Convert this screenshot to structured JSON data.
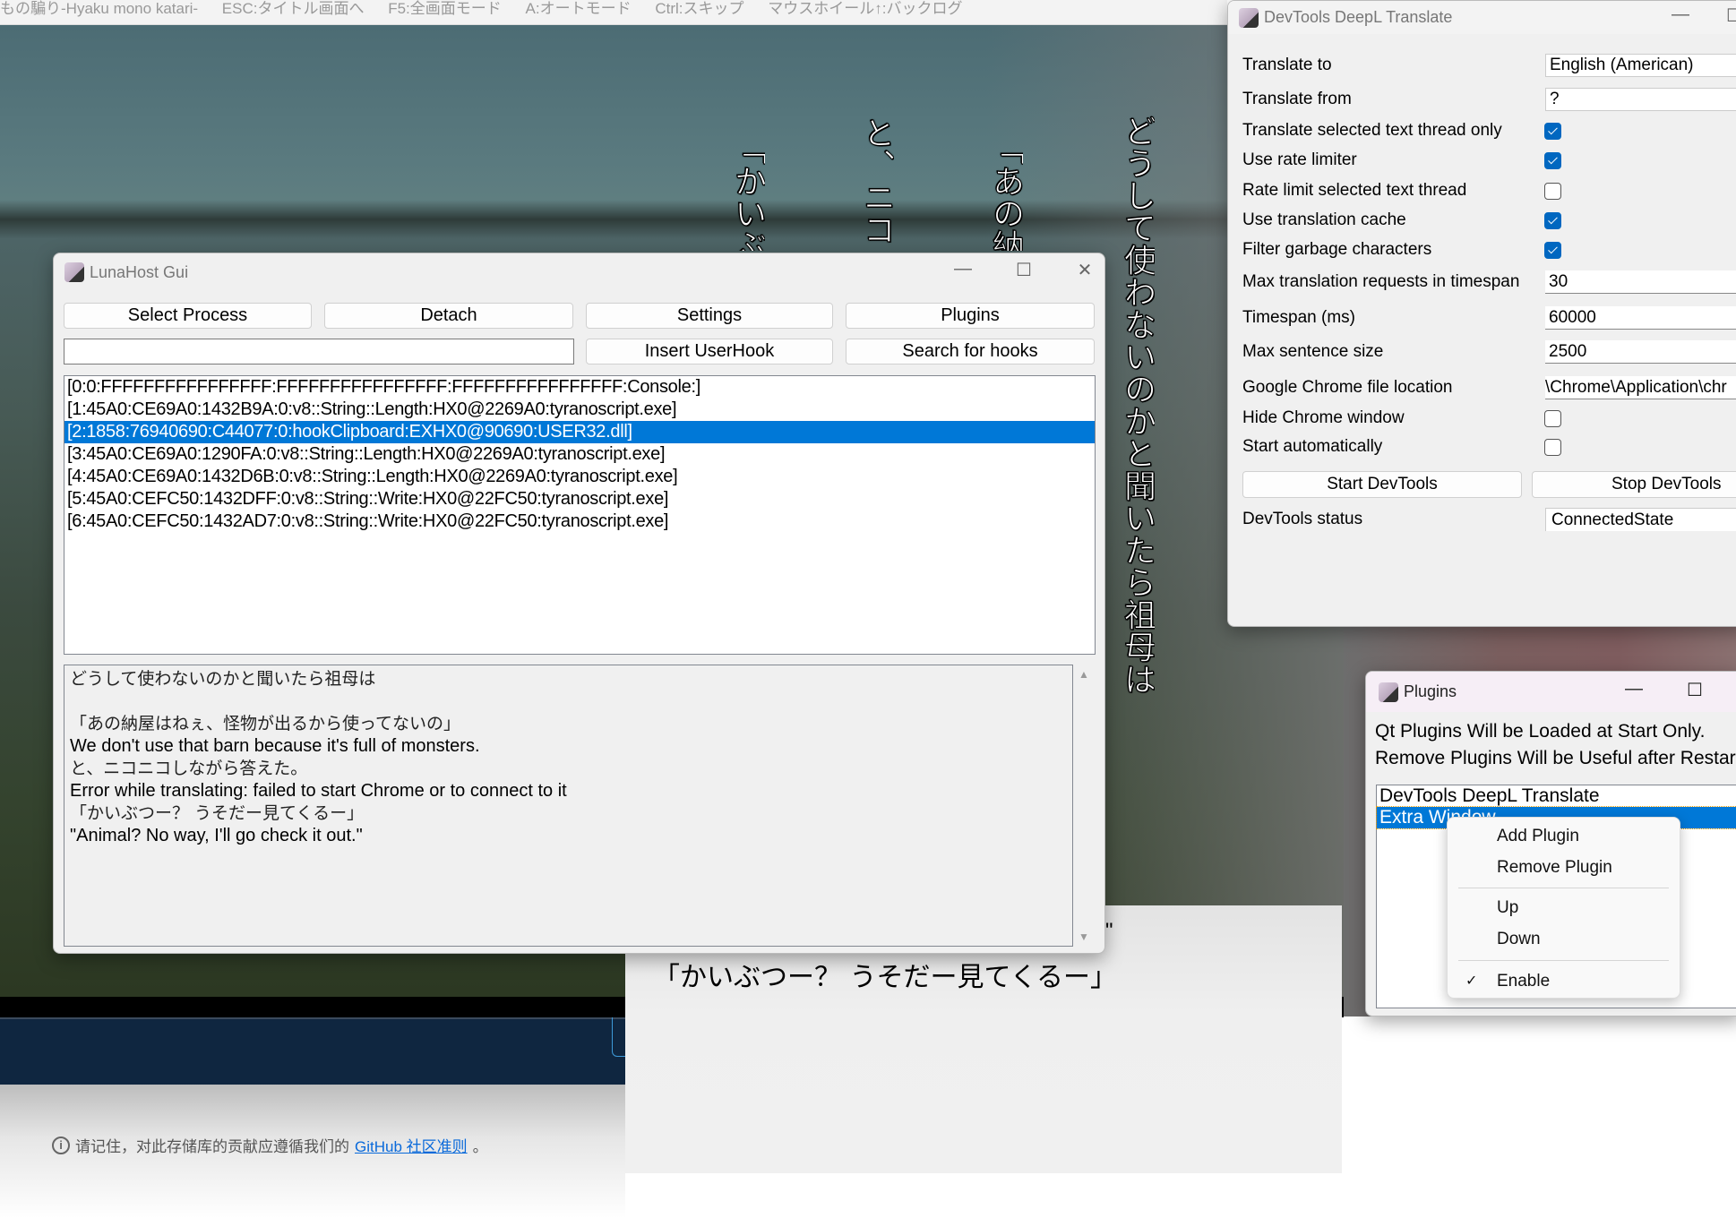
{
  "game": {
    "title_items": [
      "もの騙り-Hyaku mono katari-",
      "ESC:タイトル画面へ",
      "F5:全画面モード",
      "A:オートモード",
      "Ctrl:スキップ",
      "マウスホイール↑:バックログ"
    ],
    "vertical_text": [
      "どうして使わないのかと聞いたら祖母は",
      "「あの納",
      "と、ニコ",
      "「かいぶ"
    ]
  },
  "subtitle_panel": {
    "quote_mark": "\"",
    "line": "「かいぶつー？ うそだー見てくるー」"
  },
  "footer": {
    "text": "请记住，对此存储库的贡献应遵循我们的 ",
    "link": "GitHub 社区准则",
    "suffix": "。",
    "icon": "info-icon"
  },
  "luna": {
    "title": "LunaHost Gui",
    "buttons": {
      "select_process": "Select Process",
      "detach": "Detach",
      "settings": "Settings",
      "plugins": "Plugins",
      "insert_userhook": "Insert UserHook",
      "search_hooks": "Search for hooks"
    },
    "hook_input": "",
    "threads": [
      "[0:0:FFFFFFFFFFFFFFFF:FFFFFFFFFFFFFFFF:FFFFFFFFFFFFFFFF:Console:]",
      "[1:45A0:CE69A0:1432B9A:0:v8::String::Length:HX0@2269A0:tyranoscript.exe]",
      "[2:1858:76940690:C44077:0:hookClipboard:EXHX0@90690:USER32.dll]",
      "[3:45A0:CE69A0:1290FA:0:v8::String::Length:HX0@2269A0:tyranoscript.exe]",
      "[4:45A0:CE69A0:1432D6B:0:v8::String::Length:HX0@2269A0:tyranoscript.exe]",
      "[5:45A0:CEFC50:1432DFF:0:v8::String::Write:HX0@22FC50:tyranoscript.exe]",
      "[6:45A0:CEFC50:1432AD7:0:v8::String::Write:HX0@22FC50:tyranoscript.exe]"
    ],
    "selected_thread": 2,
    "output_lines": [
      "どうして使わないのかと聞いたら祖母は",
      "",
      "「あの納屋はねぇ、怪物が出るから使ってないの」",
      "We don't use that barn because it's full of monsters.",
      "と、ニコニコしながら答えた。",
      "Error while translating: failed to start Chrome or to connect to it",
      "「かいぶつー？ うそだー見てくるー」",
      "\"Animal? No way, I'll go check it out.\""
    ]
  },
  "devtools": {
    "title": "DevTools DeepL Translate",
    "translate_to": {
      "label": "Translate to",
      "value": "English (American)"
    },
    "translate_from": {
      "label": "Translate from",
      "value": "?"
    },
    "checks": [
      {
        "label": "Translate selected text thread only",
        "checked": true
      },
      {
        "label": "Use rate limiter",
        "checked": true
      },
      {
        "label": "Rate limit selected text thread",
        "checked": false
      },
      {
        "label": "Use translation cache",
        "checked": true
      },
      {
        "label": "Filter garbage characters",
        "checked": true
      }
    ],
    "max_requests": {
      "label": "Max translation requests in timespan",
      "value": "30"
    },
    "timespan": {
      "label": "Timespan (ms)",
      "value": "60000"
    },
    "max_sentence": {
      "label": "Max sentence size",
      "value": "2500"
    },
    "chrome_location": {
      "label": "Google Chrome file location",
      "value": "\\Chrome\\Application\\chr"
    },
    "hide_chrome": {
      "label": "Hide Chrome window",
      "checked": false
    },
    "start_auto": {
      "label": "Start automatically",
      "checked": false
    },
    "start_button": "Start DevTools",
    "stop_button": "Stop DevTools",
    "status": {
      "label": "DevTools status",
      "value": "ConnectedState"
    }
  },
  "plugins": {
    "title": "Plugins",
    "message1": "Qt Plugins Will be Loaded at Start Only.",
    "message2": "Remove Plugins Will be Useful after Restart",
    "items": [
      "DevTools DeepL Translate",
      "Extra Window"
    ],
    "selected": 1,
    "context_menu": {
      "add": "Add Plugin",
      "remove": "Remove Plugin",
      "up": "Up",
      "down": "Down",
      "enable": "Enable",
      "enable_checked": true
    }
  },
  "colors": {
    "selection": "#0078d7",
    "checkbox_on": "#0067c0",
    "link": "#0969da"
  }
}
